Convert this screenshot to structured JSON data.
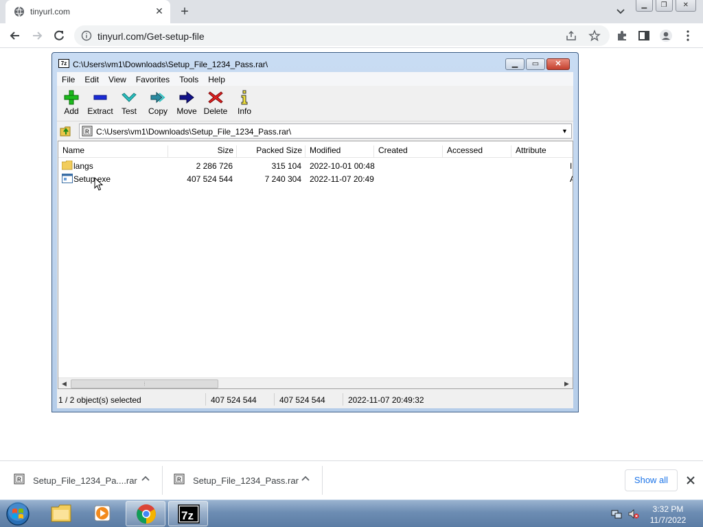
{
  "browser": {
    "tab": {
      "title": "tinyurl.com",
      "icon": "globe-icon"
    },
    "new_tab_symbol": "+",
    "address": {
      "url": "tinyurl.com/Get-setup-file"
    },
    "window_controls": [
      "minimize",
      "restore",
      "close"
    ]
  },
  "sevenzip": {
    "title": "C:\\Users\\vm1\\Downloads\\Setup_File_1234_Pass.rar\\",
    "app_icon_label": "7z",
    "menu": [
      "File",
      "Edit",
      "View",
      "Favorites",
      "Tools",
      "Help"
    ],
    "tools": [
      {
        "label": "Add",
        "icon": "green-plus-icon"
      },
      {
        "label": "Extract",
        "icon": "blue-minus-icon"
      },
      {
        "label": "Test",
        "icon": "teal-check-icon"
      },
      {
        "label": "Copy",
        "icon": "teal-double-arrow-icon"
      },
      {
        "label": "Move",
        "icon": "navy-arrow-icon"
      },
      {
        "label": "Delete",
        "icon": "red-x-icon"
      },
      {
        "label": "Info",
        "icon": "info-i-icon"
      }
    ],
    "path": "C:\\Users\\vm1\\Downloads\\Setup_File_1234_Pass.rar\\",
    "columns": [
      "Name",
      "Size",
      "Packed Size",
      "Modified",
      "Created",
      "Accessed",
      "Attribute"
    ],
    "rows": [
      {
        "name": "langs",
        "size": "2 286 726",
        "packed": "315 104",
        "modified": "2022-10-01 00:48",
        "created": "",
        "accessed": "",
        "attr": "I",
        "icon": "folder-icon"
      },
      {
        "name": "Setup.exe",
        "size": "407 524 544",
        "packed": "7 240 304",
        "modified": "2022-11-07 20:49",
        "created": "",
        "accessed": "",
        "attr": "A",
        "icon": "exe-icon"
      }
    ],
    "status": {
      "selection": "1 / 2 object(s) selected",
      "size": "407 524 544",
      "packed": "407 524 544",
      "modified": "2022-11-07 20:49:32"
    }
  },
  "downloads": {
    "items": [
      {
        "name": "Setup_File_1234_Pa....rar"
      },
      {
        "name": "Setup_File_1234_Pass.rar"
      }
    ],
    "show_all": "Show all"
  },
  "taskbar": {
    "apps": [
      "windows-explorer",
      "media-player",
      "chrome",
      "7-zip"
    ],
    "sevenzip_label": "7z",
    "time": "3:32 PM",
    "date": "11/7/2022"
  },
  "colors": {
    "chrome_tabstrip": "#dee1e6",
    "omnibox": "#f1f3f4",
    "link_blue": "#1a73e8",
    "sevenzip_frame": "#b5cde9",
    "taskbar": "#6d8db3"
  }
}
